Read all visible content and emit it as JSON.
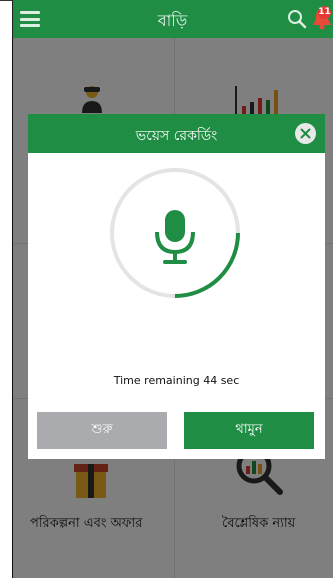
{
  "appbar": {
    "title": "বাড়ি",
    "notification_count": "11"
  },
  "tiles": [
    {
      "label": "",
      "icon": "person-icon"
    },
    {
      "label": "",
      "icon": "bar-chart-icon"
    },
    {
      "label": "পরিকল্পনা এবং অফার",
      "icon": "gift-icon"
    },
    {
      "label": "বৈশ্লেষিক ন্যায়",
      "icon": "analytics-search-icon"
    }
  ],
  "dialog": {
    "title": "ভয়েস রেকর্ডিং",
    "time_remaining": "Time remaining 44 sec",
    "start_label": "শুরু",
    "stop_label": "থামুন",
    "progress_fraction": 0.25
  },
  "colors": {
    "primary": "#1f8e44",
    "disabled_button": "#a9abaf",
    "ring_track": "#e4e4e4",
    "badge": "#e53935"
  }
}
